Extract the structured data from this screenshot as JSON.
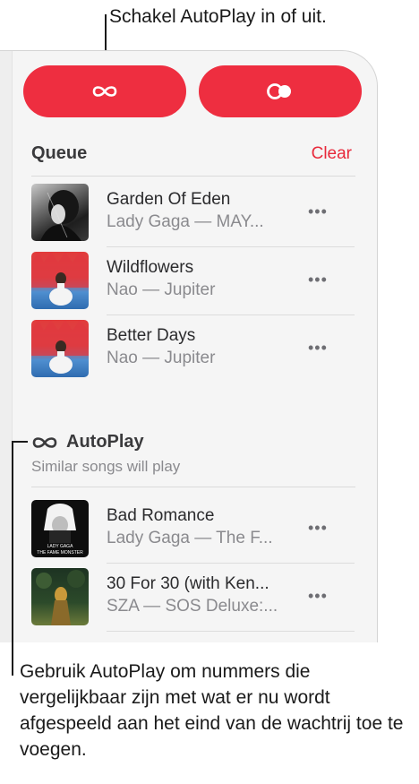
{
  "callouts": {
    "top": "Schakel AutoPlay in of uit.",
    "bottom": "Gebruik AutoPlay om nummers die vergelijkbaar zijn met wat er nu wordt afgespeeld aan het eind van de wachtrij toe te voegen."
  },
  "colors": {
    "accent": "#ee2e40",
    "clear": "#e8293b"
  },
  "buttons": {
    "autoplay_icon": "infinity-icon",
    "repeat_icon": "repeat-toggle-icon"
  },
  "queue": {
    "title": "Queue",
    "clear_label": "Clear",
    "more_label": "•••",
    "items": [
      {
        "title": "Garden Of Eden",
        "subtitle": "Lady Gaga — MAY..."
      },
      {
        "title": "Wildflowers",
        "subtitle": "Nao — Jupiter"
      },
      {
        "title": "Better Days",
        "subtitle": "Nao — Jupiter"
      }
    ]
  },
  "autoplay": {
    "icon": "infinity-icon",
    "title": "AutoPlay",
    "subtitle": "Similar songs will play",
    "items": [
      {
        "title": "Bad Romance",
        "subtitle": "Lady Gaga — The F..."
      },
      {
        "title": "30 For 30 (with Ken...",
        "subtitle": "SZA — SOS Deluxe:..."
      }
    ]
  },
  "art_text": {
    "bad_romance_line1": "LADY GAGA",
    "bad_romance_line2": "THE FAME MONSTER"
  }
}
